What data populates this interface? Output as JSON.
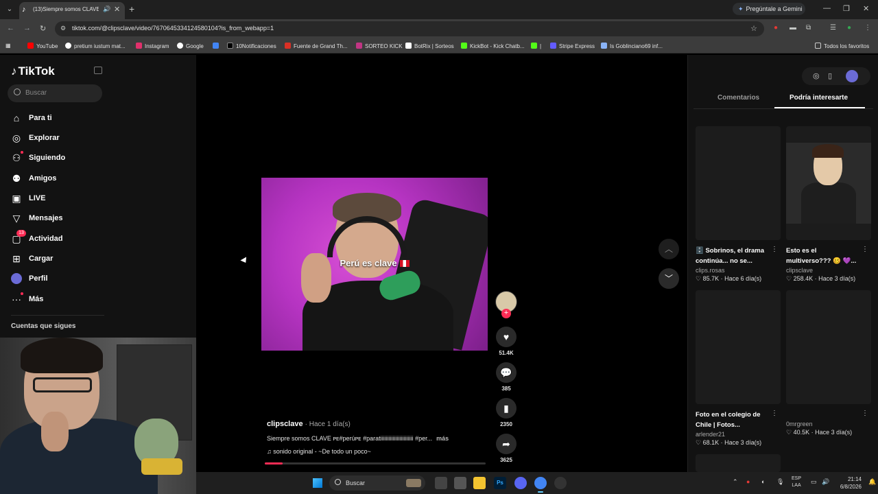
{
  "browser": {
    "tab_title": "(13)Siempre somos CLAVE",
    "gemini_label": "Pregúntale a Gemini",
    "url": "tiktok.com/@clipsclave/video/7670645334124580104?is_from_webapp=1",
    "bookmarks": [
      {
        "label": "YouTube",
        "color": "#ff0000"
      },
      {
        "label": "pretium iustum mat...",
        "color": "#ffffff"
      },
      {
        "label": "Instagram",
        "color": "#e1306c"
      },
      {
        "label": "Google",
        "color": "#ffffff"
      },
      {
        "label": "",
        "color": "#4285f4"
      },
      {
        "label": "10Notificaciones",
        "color": "#000000"
      },
      {
        "label": "Fuente de Grand Th...",
        "color": "#d93025"
      },
      {
        "label": "SORTEO KICK",
        "color": "#c13584"
      },
      {
        "label": "BotRix | Sorteos",
        "color": "#ffffff"
      },
      {
        "label": "KickBot - Kick Chatb...",
        "color": "#53fc18"
      },
      {
        "label": "|",
        "color": "#53fc18"
      },
      {
        "label": "Stripe Express",
        "color": "#635bff"
      },
      {
        "label": "Is Goblinciano69 inf...",
        "color": "#8ab4f8"
      }
    ],
    "all_bookmarks": "Todos los favoritos"
  },
  "sidebar": {
    "logo": "TikTok",
    "search_placeholder": "Buscar",
    "items": [
      {
        "label": "Para ti",
        "icon": "home-icon"
      },
      {
        "label": "Explorar",
        "icon": "compass-icon"
      },
      {
        "label": "Siguiendo",
        "icon": "following-icon"
      },
      {
        "label": "Amigos",
        "icon": "friends-icon"
      },
      {
        "label": "LIVE",
        "icon": "live-icon"
      },
      {
        "label": "Mensajes",
        "icon": "send-icon"
      },
      {
        "label": "Actividad",
        "icon": "activity-icon",
        "badge": "13"
      },
      {
        "label": "Cargar",
        "icon": "upload-icon"
      },
      {
        "label": "Perfil",
        "icon": "avatar-icon"
      },
      {
        "label": "Más",
        "icon": "more-icon"
      }
    ],
    "following_title": "Cuentas que sigues"
  },
  "video": {
    "overlay_text": "Perú es clave",
    "author": "clipsclave",
    "posted": "· Hace 1 día(s)",
    "caption": "Siempre somos CLAVE ᴘᴇ#perúᴘᴇ #paratiiiiiiiiiiiiiiiiiiiiiiii #per...",
    "more": "más",
    "sound": "sonido original - ~De todo un poco~",
    "progress": 0.08,
    "likes": "51.4K",
    "comments": "385",
    "saves": "2350",
    "shares": "3625"
  },
  "right_panel": {
    "tab_comments": "Comentarios",
    "tab_recommended": "Podría interesarte",
    "cards": [
      {
        "title": "🗄️ Sobrinos, el drama continúa... no se...",
        "owner": "clips.rosas",
        "stats": "♡ 85.7K · Hace 6 día(s)"
      },
      {
        "title": "Esto es el multiverso??? 🥴 💜...",
        "owner": "clipsclave",
        "stats": "♡ 258.4K · Hace 3 día(s)"
      },
      {
        "title": "Foto en el colegio de Chile | Fotos...",
        "owner": "arlender21",
        "stats": "♡ 68.1K · Hace 3 día(s)"
      },
      {
        "title": "",
        "owner": "0mrgreen",
        "stats": "♡ 40.5K · Hace 3 día(s)"
      }
    ]
  },
  "taskbar": {
    "search_label": "Buscar",
    "lang_top": "ESP",
    "lang_bottom": "LAA",
    "time": "21:14",
    "date": "6/8/2026"
  }
}
